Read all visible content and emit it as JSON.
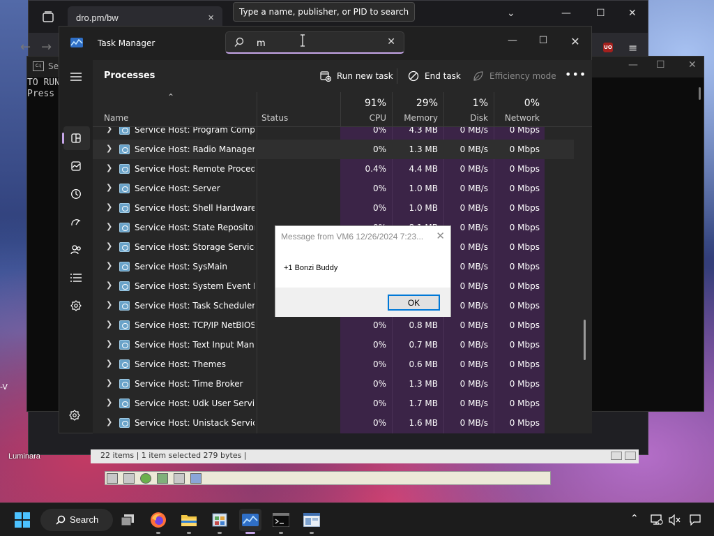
{
  "browser": {
    "tab_title": "dro.pm/bw",
    "close_glyph": "×",
    "dropdown_glyph": "⌄",
    "minimize_glyph": "—",
    "maximize_glyph": "☐",
    "window_close_glyph": "✕",
    "back_glyph": "←",
    "forward_glyph": "→",
    "menu_glyph": "≡",
    "ublock_text": "UO"
  },
  "console": {
    "title": "Se",
    "line1": "TO RUN",
    "line2": "Press"
  },
  "explorer": {
    "status": "22 items  |  1 item selected  279 bytes  |"
  },
  "desktop": {
    "label": "Luminara",
    "edge_text": "-V"
  },
  "tooltip": {
    "text": "Type a name, publisher, or PID to search"
  },
  "task_manager": {
    "title": "Task Manager",
    "search_value": "m",
    "search_placeholder": "Type a name, publisher, or PID to search",
    "page_title": "Processes",
    "commands": {
      "run_new_task": "Run new task",
      "end_task": "End task",
      "efficiency_mode": "Efficiency mode"
    },
    "columns": {
      "name": "Name",
      "status": "Status",
      "cpu": {
        "pct": "91%",
        "label": "CPU"
      },
      "memory": {
        "pct": "29%",
        "label": "Memory"
      },
      "disk": {
        "pct": "1%",
        "label": "Disk"
      },
      "network": {
        "pct": "0%",
        "label": "Network"
      }
    },
    "rows": [
      {
        "name": "Service Host: Program Compati...",
        "status": "",
        "cpu": "0%",
        "memory": "4.3 MB",
        "disk": "0 MB/s",
        "network": "0 Mbps"
      },
      {
        "name": "Service Host: Radio Managem...",
        "status": "",
        "cpu": "0%",
        "memory": "1.3 MB",
        "disk": "0 MB/s",
        "network": "0 Mbps"
      },
      {
        "name": "Service Host: Remote Procedu...",
        "status": "",
        "cpu": "0.4%",
        "memory": "4.4 MB",
        "disk": "0 MB/s",
        "network": "0 Mbps"
      },
      {
        "name": "Service Host: Server",
        "status": "",
        "cpu": "0%",
        "memory": "1.0 MB",
        "disk": "0 MB/s",
        "network": "0 Mbps"
      },
      {
        "name": "Service Host: Shell Hardware ...",
        "status": "",
        "cpu": "0%",
        "memory": "1.0 MB",
        "disk": "0 MB/s",
        "network": "0 Mbps"
      },
      {
        "name": "Service Host: State Repository ...",
        "status": "",
        "cpu": "0%",
        "memory": "8.1 MB",
        "disk": "0 MB/s",
        "network": "0 Mbps"
      },
      {
        "name": "Service Host: Storage Service",
        "status": "",
        "cpu": "",
        "memory": "",
        "disk": "0 MB/s",
        "network": "0 Mbps"
      },
      {
        "name": "Service Host: SysMain",
        "status": "",
        "cpu": "",
        "memory": "",
        "disk": "0 MB/s",
        "network": "0 Mbps"
      },
      {
        "name": "Service Host: System Event No...",
        "status": "",
        "cpu": "",
        "memory": "",
        "disk": "0 MB/s",
        "network": "0 Mbps"
      },
      {
        "name": "Service Host: Task Scheduler",
        "status": "",
        "cpu": "",
        "memory": "",
        "disk": "0 MB/s",
        "network": "0 Mbps"
      },
      {
        "name": "Service Host: TCP/IP NetBIOS ...",
        "status": "",
        "cpu": "0%",
        "memory": "0.8 MB",
        "disk": "0 MB/s",
        "network": "0 Mbps"
      },
      {
        "name": "Service Host: Text Input Mana...",
        "status": "",
        "cpu": "0%",
        "memory": "0.7 MB",
        "disk": "0 MB/s",
        "network": "0 Mbps"
      },
      {
        "name": "Service Host: Themes",
        "status": "",
        "cpu": "0%",
        "memory": "0.6 MB",
        "disk": "0 MB/s",
        "network": "0 Mbps"
      },
      {
        "name": "Service Host: Time Broker",
        "status": "",
        "cpu": "0%",
        "memory": "1.3 MB",
        "disk": "0 MB/s",
        "network": "0 Mbps"
      },
      {
        "name": "Service Host: Udk User Service...",
        "status": "",
        "cpu": "0%",
        "memory": "1.7 MB",
        "disk": "0 MB/s",
        "network": "0 Mbps"
      },
      {
        "name": "Service Host: Unistack Service ...",
        "status": "",
        "cpu": "0%",
        "memory": "1.6 MB",
        "disk": "0 MB/s",
        "network": "0 Mbps"
      }
    ],
    "sidebar_icons": [
      "hamburger-icon",
      "processes-icon",
      "performance-icon",
      "app-history-icon",
      "startup-apps-icon",
      "users-icon",
      "details-icon",
      "services-icon",
      "settings-icon"
    ],
    "accent_color": "#c6a6e8",
    "heat_color": "#3b2447"
  },
  "message_box": {
    "title": "Message from VM6 12/26/2024 7:23...",
    "body": "+1 Bonzi Buddy",
    "ok_label": "OK"
  },
  "taskbar": {
    "search_label": "Search",
    "icons": [
      "windows-start-icon",
      "task-view-icon",
      "firefox-icon",
      "file-explorer-icon",
      "control-panel-icon",
      "task-manager-icon",
      "terminal-icon",
      "vm-app-icon"
    ],
    "tray": [
      "chevron-up-icon",
      "network-disconnected-icon",
      "volume-muted-icon",
      "notification-icon"
    ]
  }
}
